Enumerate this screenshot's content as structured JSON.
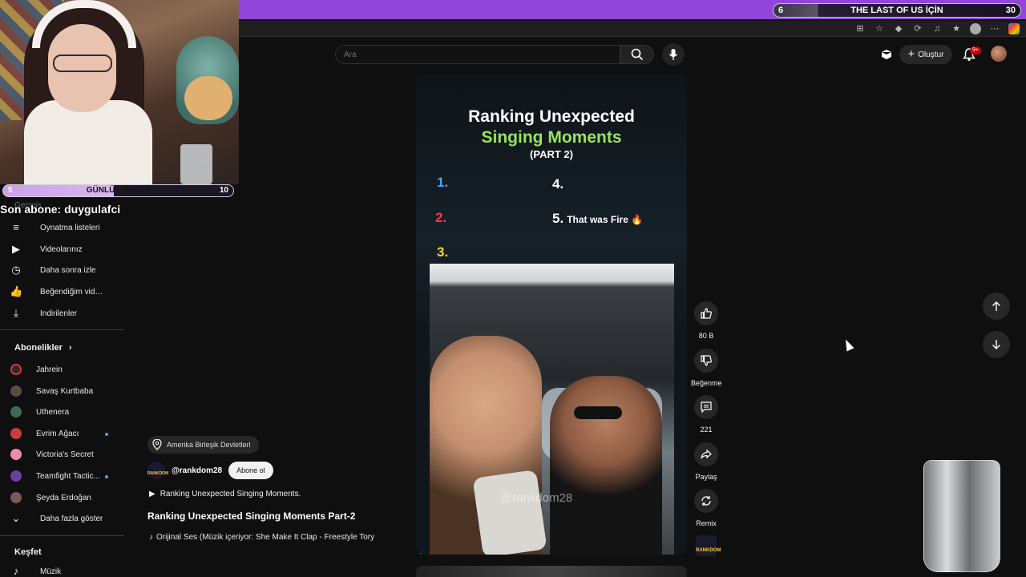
{
  "stream": {
    "goal_left": "6",
    "goal_title": "THE LAST OF US İÇİN",
    "goal_right": "30",
    "daily_left": "5",
    "daily_title": "GÜNLÜK HEDEF",
    "daily_right": "10",
    "last_sub": "Son abone: duygulafci"
  },
  "sidebar": {
    "ghost_item": "Geçmiş",
    "items": [
      {
        "label": "Oynatma listeleri",
        "icon": "playlist-icon"
      },
      {
        "label": "Videolarınız",
        "icon": "video-icon"
      },
      {
        "label": "Daha sonra izle",
        "icon": "clock-icon"
      },
      {
        "label": "Beğendiğim videolar",
        "icon": "thumbs-up-icon"
      },
      {
        "label": "İndirilenler",
        "icon": "download-icon"
      }
    ],
    "subs_title": "Abonelikler",
    "subs": [
      {
        "label": "Jahrein",
        "color": "#2b2b2b"
      },
      {
        "label": "Savaş Kurtbaba",
        "color": "#5a4a44"
      },
      {
        "label": "Uthenera",
        "color": "#3d6b4f"
      },
      {
        "label": "Evrim Ağacı",
        "color": "#c83c3c"
      },
      {
        "label": "Victoria's Secret",
        "color": "#f08aa8"
      },
      {
        "label": "Teamfight Tactic...",
        "color": "#6b3fa0"
      },
      {
        "label": "Şeyda Erdoğan",
        "color": "#7a5a55"
      }
    ],
    "show_more": "Daha fazla göster",
    "explore_title": "Keşfet",
    "explore_first": "Müzik"
  },
  "search": {
    "placeholder": "Ara"
  },
  "header": {
    "create_label": "Oluştur",
    "bell_badge": "9+"
  },
  "short": {
    "title_line1": "Ranking Unexpected",
    "title_line2": "Singing Moments",
    "title_line3": "(PART 2)",
    "rank1": "1.",
    "rank2": "2.",
    "rank3": "3.",
    "rank4": "4.",
    "rank5": "5.",
    "rank5_text": "That was Fire 🔥",
    "watermark": "@rankdom28",
    "progress": 0.02
  },
  "actions": {
    "likes": "80 B",
    "dislike": "Beğenme",
    "comments": "221",
    "share": "Paylaş",
    "remix": "Remix",
    "channel_mini": "RANKDOM"
  },
  "video_info": {
    "location": "Amerika Birleşik Devletleri",
    "channel": "@rankdom28",
    "subscribe": "Abone ol",
    "description": "Ranking Unexpected Singing Moments.",
    "title": "Ranking Unexpected Singing Moments Part-2",
    "sound": "Orijinal Ses (Müzik içeriyor: She Make It Clap - Freestyle Tory",
    "channel_avatar_text": "RANKDOM"
  },
  "colors": {
    "stream_purple": "#9146d9",
    "rank1": "#4aa3ff",
    "rank2": "#ff3b3b",
    "rank3": "#ffd43b",
    "title_green": "#9be35c"
  }
}
